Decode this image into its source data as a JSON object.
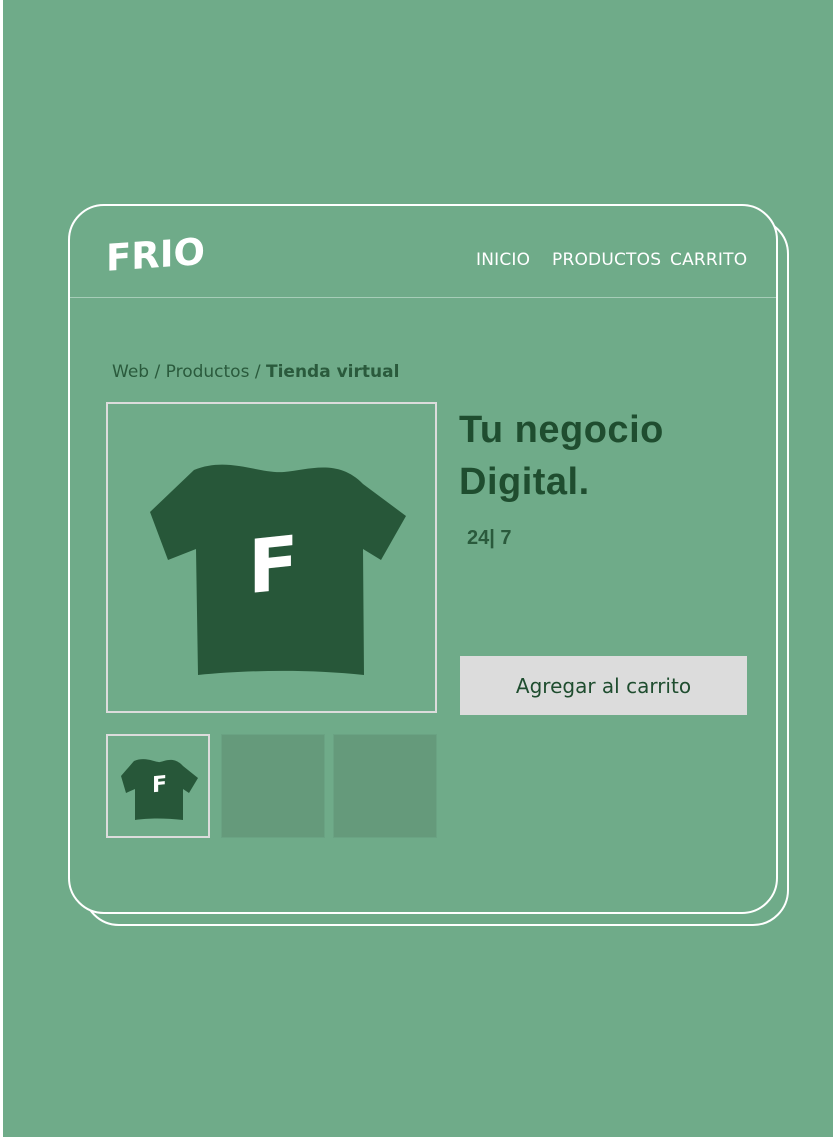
{
  "brand": {
    "logo_text": "FRIO"
  },
  "nav": {
    "inicio": "INICIO",
    "productos": "PRODUCTOS",
    "carrito": "CARRITO"
  },
  "breadcrumb": {
    "web": "Web",
    "sep1": " / ",
    "productos": "Productos",
    "sep2": " / ",
    "current": "Tienda virtual"
  },
  "product": {
    "title_line1": "Tu negocio",
    "title_line2": "Digital.",
    "hours": "24| 7",
    "tshirt_letter": "F",
    "add_to_cart": "Agregar al carrito"
  },
  "colors": {
    "background": "#6fab89",
    "tshirt": "#275739",
    "title": "#1f4d2f",
    "button": "#dcdcdc",
    "outline": "#ffffff"
  }
}
